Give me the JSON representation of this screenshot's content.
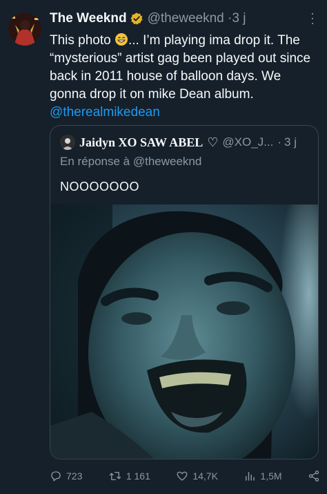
{
  "tweet": {
    "author_name": "The Weeknd",
    "author_handle": "@theweeknd",
    "separator": "·",
    "time": "3 j",
    "text_part1": "This photo ",
    "text_part2": "... I’m playing ima drop it. The “mysterious” artist gag been played out since back in 2011 house of balloon days. We gonna drop it on mike Dean album.",
    "mention": "@therealmikedean",
    "emoji": "grinning-sweat-emoji",
    "verified_icon": "verified-badge-icon",
    "more_icon": "more-options-icon"
  },
  "quote": {
    "author_name": "Jaidyn XO SAW ABEL",
    "heart": "♡",
    "author_handle": "@XO_J...",
    "separator": "·",
    "time": "3 j",
    "reply_to": "En réponse à @theweeknd",
    "text": "NOOOOOOO"
  },
  "actions": {
    "replies": "723",
    "reposts": "1 161",
    "likes": "14,7K",
    "views": "1,5M"
  },
  "colors": {
    "background": "#15202b",
    "text": "#f7f9f9",
    "muted": "#8b98a5",
    "link": "#1d9bf0",
    "border": "#38444d",
    "verified": "#e8b226"
  }
}
